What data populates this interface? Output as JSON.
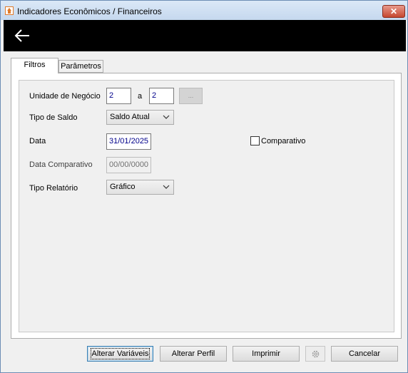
{
  "window": {
    "title": "Indicadores Econômicos / Financeiros",
    "close_label": "✕"
  },
  "tabs": [
    {
      "label": "Filtros",
      "active": true
    },
    {
      "label": "Parâmetros",
      "active": false
    }
  ],
  "form": {
    "unidade_negocio": {
      "label": "Unidade de Negócio",
      "from": "2",
      "separator": "a",
      "to": "2",
      "lookup_label": "..."
    },
    "tipo_saldo": {
      "label": "Tipo de Saldo",
      "selected": "Saldo Atual"
    },
    "data": {
      "label": "Data",
      "value": "31/01/2025"
    },
    "comparativo": {
      "label": "Comparativo",
      "checked": false
    },
    "data_comparativo": {
      "label": "Data Comparativo",
      "value": "00/00/0000"
    },
    "tipo_relatorio": {
      "label": "Tipo Relatório",
      "selected": "Gráfico"
    }
  },
  "buttons": {
    "alterar_variaveis": "Alterar Variáveis",
    "alterar_perfil": "Alterar Perfil",
    "imprimir": "Imprimir",
    "cancelar": "Cancelar"
  },
  "icons": {
    "back": "back-arrow-icon",
    "settings": "gear-icon",
    "app": "home-icon"
  }
}
